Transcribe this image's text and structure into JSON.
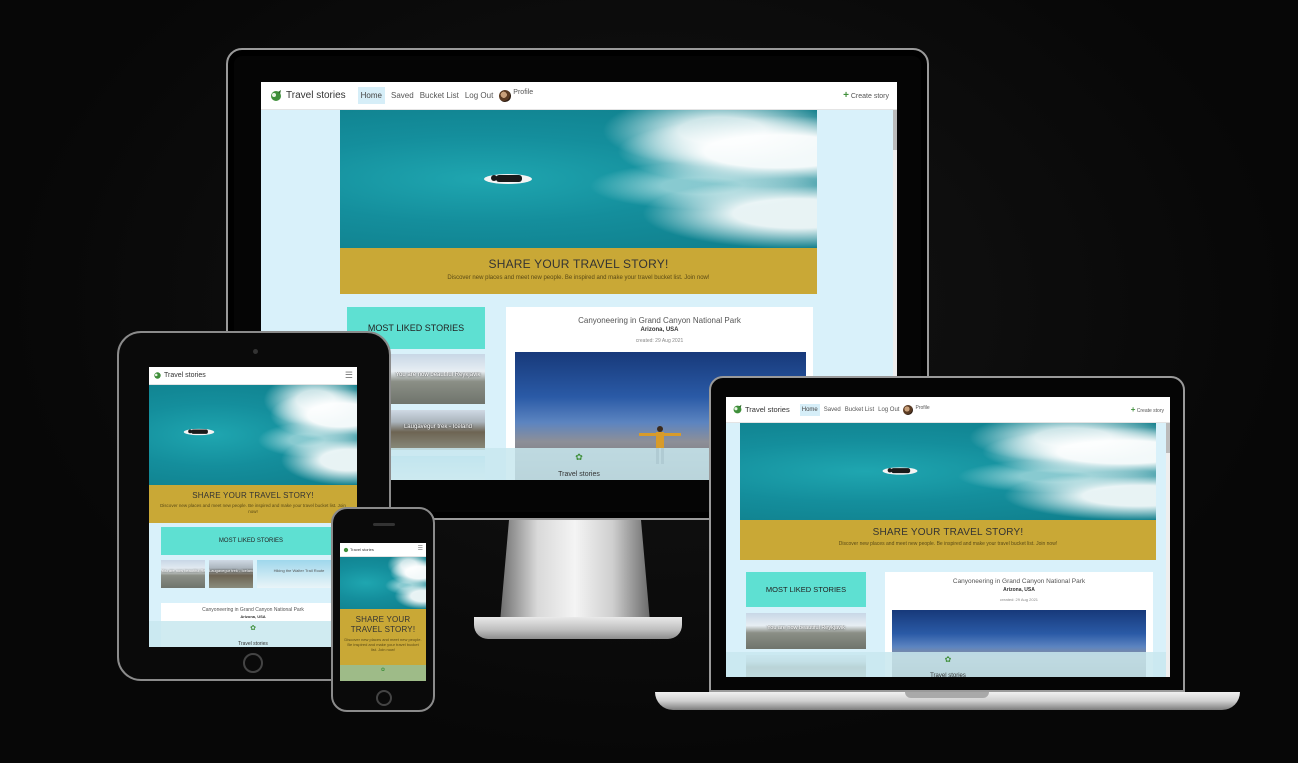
{
  "site": {
    "brand": "Travel stories",
    "nav": {
      "home": "Home",
      "saved": "Saved",
      "bucket_list": "Bucket List",
      "log_out": "Log Out",
      "profile": "Profile",
      "create_story": "Create story"
    },
    "hero": {
      "heading": "SHARE YOUR TRAVEL STORY!",
      "subtext": "Discover new places and meet new people. Be inspired and make your travel bucket list. Join now!",
      "subtext_short": "Discover new places and meet new people. Be inspired and make your travel bucket list. Join now!"
    },
    "most_liked": {
      "title": "MOST LIKED STORIES",
      "items": [
        "You are now beautiful Reykjavik",
        "Laugavegur trek - Iceland",
        "Hiking the Walter Trail Route"
      ]
    },
    "story": {
      "title": "Canyoneering in Grand Canyon National Park",
      "location": "Arizona, USA",
      "created": "created: 29 Aug 2021"
    },
    "footer": "Travel stories",
    "phone_heading_line1": "SHARE YOUR",
    "phone_heading_line2": "TRAVEL STORY!"
  },
  "colors": {
    "page_bg": "#d9f1fa",
    "banner": "#c9a836",
    "most_liked": "#5ee0d2",
    "nav_active": "#d6eef8"
  },
  "icons": {
    "logo": "globe-leaf-icon",
    "plus": "plus-icon",
    "menu": "hamburger-icon"
  }
}
